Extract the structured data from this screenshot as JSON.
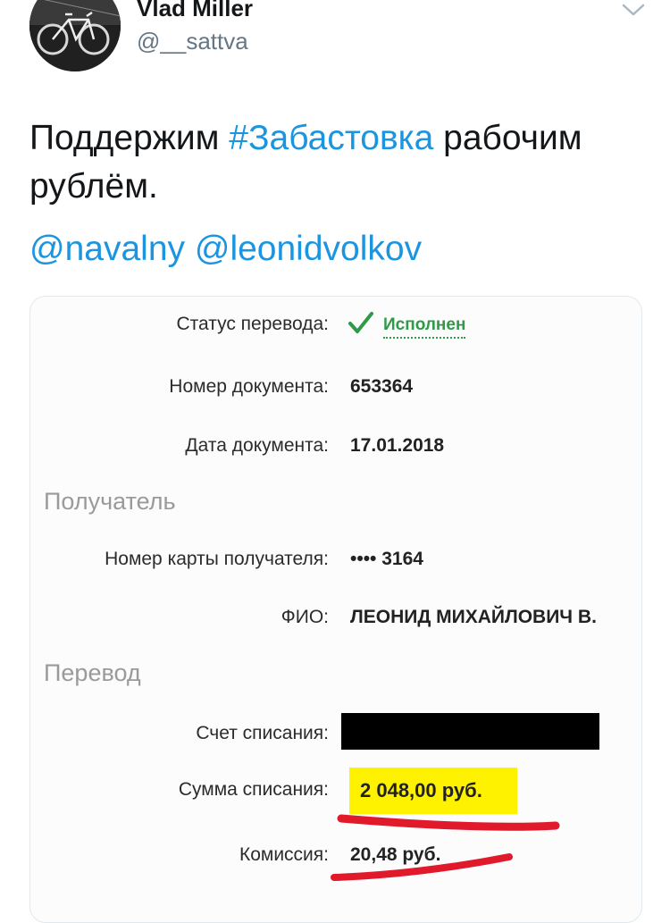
{
  "author": {
    "display_name": "Vlad Miller",
    "handle": "@__sattva"
  },
  "tweet": {
    "text_before": "Поддержим ",
    "hashtag": "#Забастовка",
    "text_after": " рабочим рублём.",
    "mentions": [
      "@navalny",
      "@leonidvolkov"
    ]
  },
  "receipt": {
    "status_label": "Статус перевода:",
    "status_value": "Исполнен",
    "doc_number_label": "Номер документа:",
    "doc_number_value": "653364",
    "doc_date_label": "Дата документа:",
    "doc_date_value": "17.01.2018",
    "recipient_section": "Получатель",
    "card_label": "Номер карты получателя:",
    "card_value": "•••• 3164",
    "fio_label": "ФИО:",
    "fio_value": "ЛЕОНИД МИХАЙЛОВИЧ В.",
    "transfer_section": "Перевод",
    "account_label": "Счет списания:",
    "amount_label": "Сумма списания:",
    "amount_value": "2 048,00  руб.",
    "fee_label": "Комиссия:",
    "fee_value": "20,48 руб."
  },
  "colors": {
    "link": "#1b95e0",
    "status_green": "#2f9a48",
    "highlight_yellow": "#fff200",
    "scribble_red": "#e0192b"
  },
  "icons": {
    "caret": "chevron-down-icon",
    "status": "checkmark-icon"
  }
}
